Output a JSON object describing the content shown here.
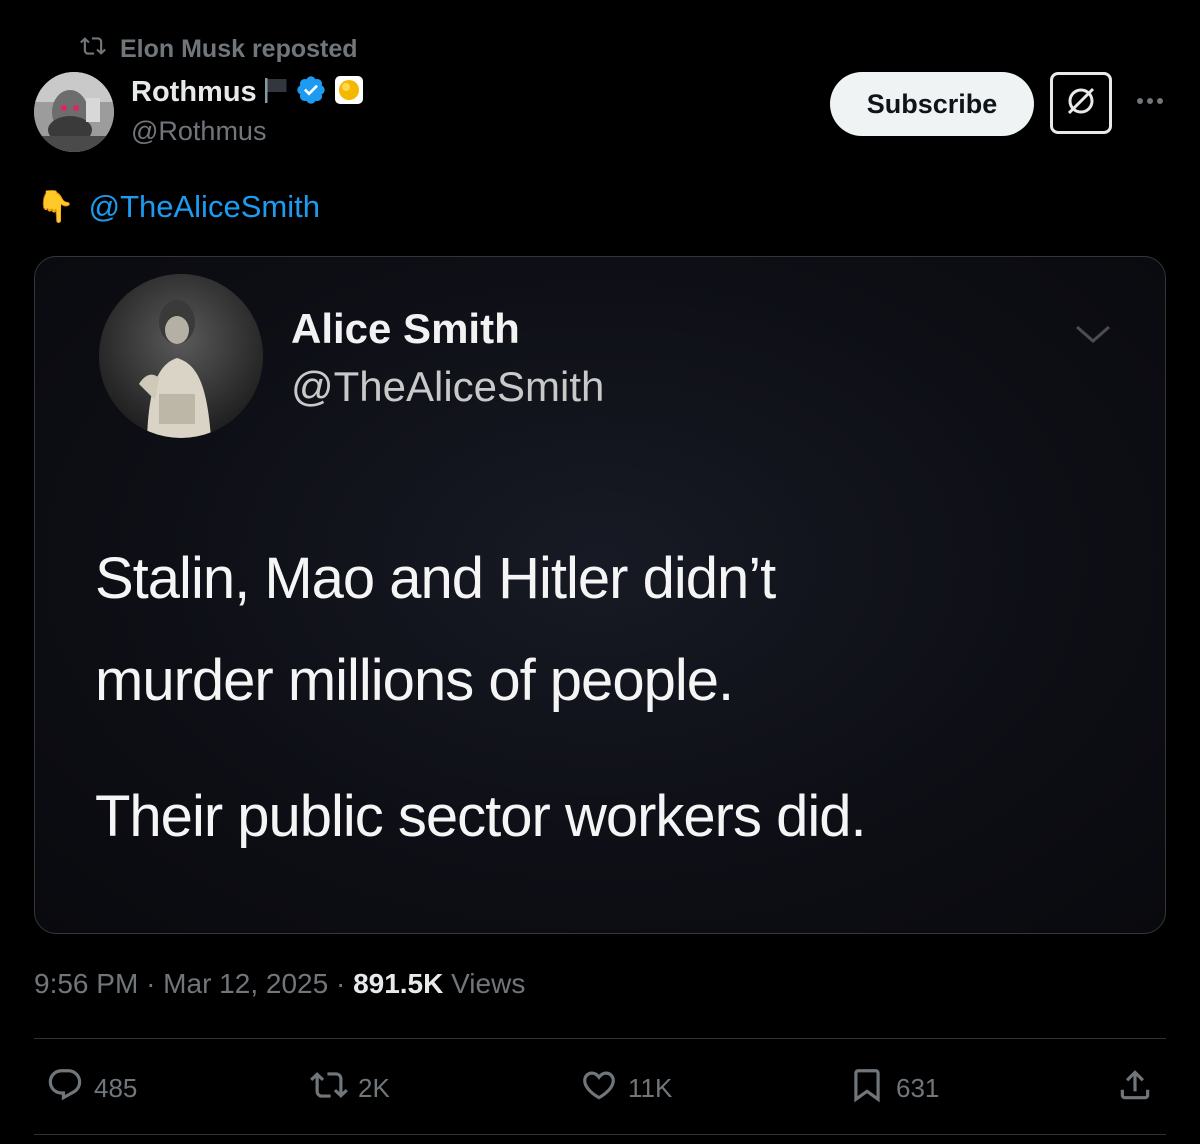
{
  "repost": {
    "label": "Elon Musk reposted"
  },
  "author": {
    "display_name": "Rothmus",
    "handle": "@Rothmus",
    "verified_color": "#1d9bf0"
  },
  "header": {
    "subscribe_label": "Subscribe"
  },
  "tweet": {
    "emoji": "👇",
    "mention": "@TheAliceSmith"
  },
  "quoted_image": {
    "name": "Alice Smith",
    "handle": "@TheAliceSmith",
    "lines": [
      "Stalin, Mao and Hitler didn’t",
      "murder millions of people.",
      "Their public sector workers did."
    ]
  },
  "meta": {
    "time": "9:56 PM",
    "separator": "·",
    "date": "Mar 12, 2025",
    "views_count": "891.5K",
    "views_label": "Views"
  },
  "actions": {
    "replies": "485",
    "reposts": "2K",
    "likes": "11K",
    "bookmarks": "631"
  },
  "colors": {
    "background": "#000000",
    "accent": "#1d9bf0",
    "muted": "#71767b"
  }
}
